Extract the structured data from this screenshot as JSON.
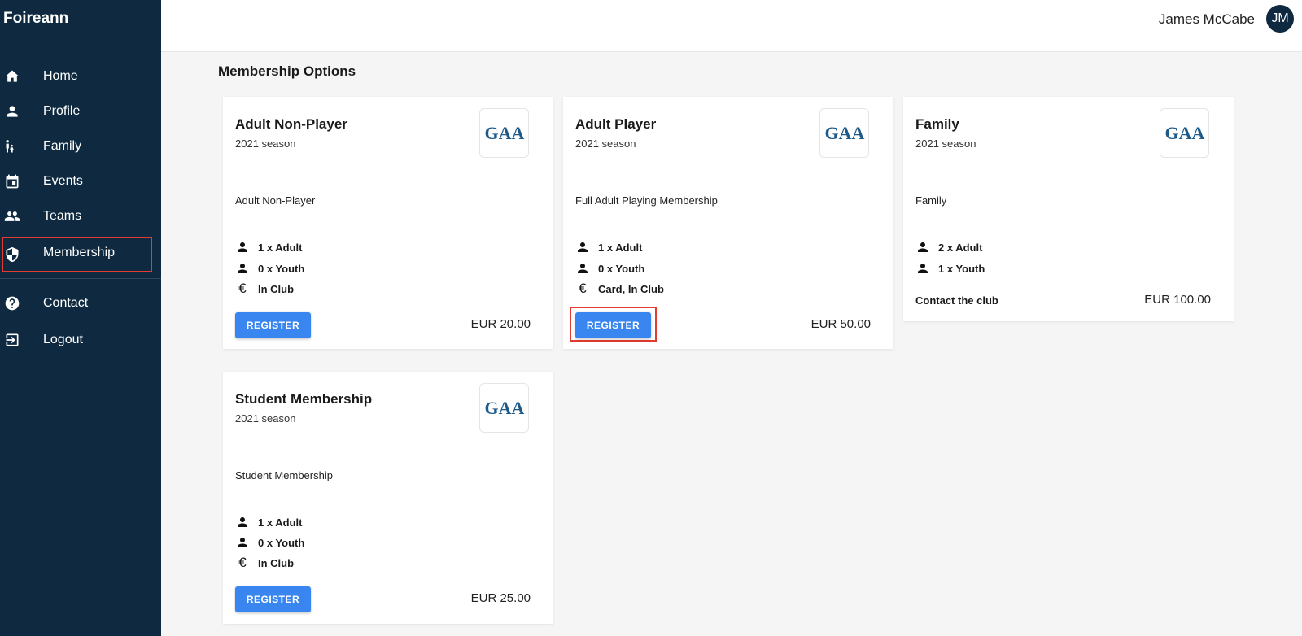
{
  "app": {
    "brand": "Foireann"
  },
  "sidebar": {
    "items": [
      {
        "label": "Home",
        "icon": "home-icon"
      },
      {
        "label": "Profile",
        "icon": "person-icon"
      },
      {
        "label": "Family",
        "icon": "family-icon"
      },
      {
        "label": "Events",
        "icon": "calendar-icon"
      },
      {
        "label": "Teams",
        "icon": "group-icon"
      },
      {
        "label": "Membership",
        "icon": "shield-icon",
        "selected": true
      },
      {
        "label": "Contact",
        "icon": "help-icon"
      },
      {
        "label": "Logout",
        "icon": "logout-icon"
      }
    ]
  },
  "header": {
    "user_name": "James McCabe",
    "user_initials": "JM"
  },
  "main": {
    "title": "Membership Options",
    "cards": [
      {
        "name": "Adult Non-Player",
        "season": "2021 season",
        "description": "Adult Non-Player",
        "features": [
          {
            "icon": "person-icon",
            "text": "1 x Adult"
          },
          {
            "icon": "person-icon",
            "text": "0 x Youth"
          },
          {
            "icon": "euro-icon",
            "text": "In Club"
          }
        ],
        "button_label": "REGISTER",
        "price": "EUR 20.00"
      },
      {
        "name": "Adult Player",
        "season": "2021 season",
        "description": "Full Adult Playing Membership",
        "features": [
          {
            "icon": "person-icon",
            "text": "1 x Adult"
          },
          {
            "icon": "person-icon",
            "text": "0 x Youth"
          },
          {
            "icon": "euro-icon",
            "text": "Card, In Club"
          }
        ],
        "button_label": "REGISTER",
        "price": "EUR 50.00"
      },
      {
        "name": "Family",
        "season": "2021 season",
        "description": "Family",
        "features": [
          {
            "icon": "person-icon",
            "text": "2 x Adult"
          },
          {
            "icon": "person-icon",
            "text": "1 x Youth"
          }
        ],
        "contact_label": "Contact the club",
        "price": "EUR 100.00"
      },
      {
        "name": "Student Membership",
        "season": "2021 season",
        "description": "Student Membership",
        "features": [
          {
            "icon": "person-icon",
            "text": "1 x Adult"
          },
          {
            "icon": "person-icon",
            "text": "0 x Youth"
          },
          {
            "icon": "euro-icon",
            "text": "In Club"
          }
        ],
        "button_label": "REGISTER",
        "price": "EUR 25.00"
      }
    ]
  },
  "logo": {
    "text": "GAA",
    "color": "#1d5a8a"
  },
  "colors": {
    "sidebar": "#0f2a40",
    "button": "#3a86f0",
    "highlight": "#e23b30"
  }
}
